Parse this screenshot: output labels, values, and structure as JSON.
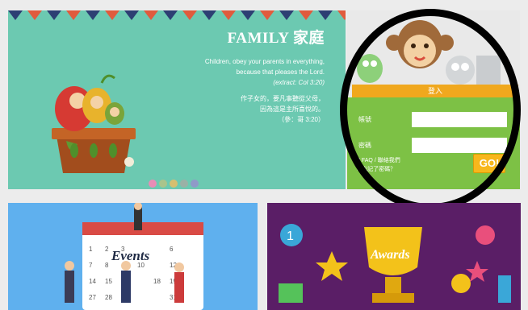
{
  "banner": {
    "title": "FAMILY 家庭",
    "quote_en_line1": "Children, obey your parents in everything,",
    "quote_en_line2": "because that pleases the Lord.",
    "quote_en_ref": "(extract: Col 3:20)",
    "quote_zh_line1": "作子女的，要凡事聽從父母，",
    "quote_zh_line2": "因為這是主所喜悅的。",
    "quote_zh_ref": "（參：哥 3:20）",
    "slide_dots": [
      "#e98cb6",
      "#a9c48c",
      "#d6bf6f",
      "#9ab1a6",
      "#8f9ac8"
    ]
  },
  "login": {
    "header": "登入",
    "account_label": "帳號",
    "password_label": "密碼",
    "account_value": "",
    "password_value": "",
    "faq_link": "FAQ",
    "contact_link": "聯絡我們",
    "forgot_link": "忘記了密碼？",
    "submit_label": "GO!"
  },
  "cards": {
    "events_title": "Events",
    "awards_title": "Awards"
  },
  "colors": {
    "banner_bg": "#6cc9b1",
    "login_green": "#7dc145",
    "login_orange": "#f0a81e",
    "go_yellow": "#f7b71c"
  }
}
